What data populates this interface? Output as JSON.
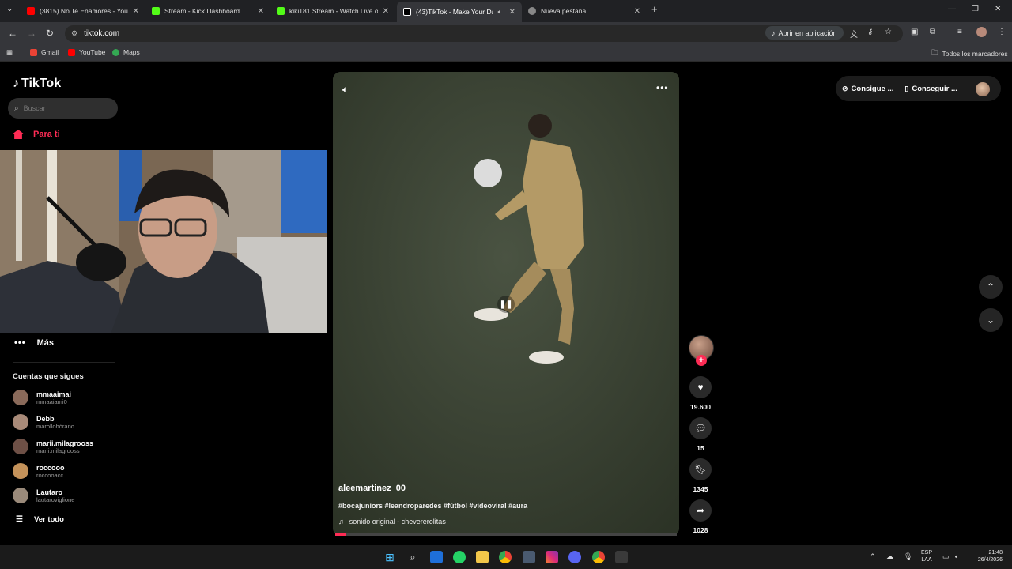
{
  "browser": {
    "tabs": [
      {
        "title": "(3815) No Te Enamores - YouTu",
        "color": "#ff0000"
      },
      {
        "title": "Stream - Kick Dashboard",
        "color": "#53fc18"
      },
      {
        "title": "kiki181 Stream - Watch Live on",
        "color": "#53fc18"
      },
      {
        "title": "(43)TikTok - Make Your Day",
        "color": "#ffffff"
      },
      {
        "title": "Nueva pestaña",
        "color": "#888888"
      }
    ],
    "new_tab_glyph": "+",
    "url": "tiktok.com",
    "open_in_app": "Abrir en aplicación",
    "bookmarks": [
      {
        "label": "Gmail",
        "color": "#ea4335"
      },
      {
        "label": "YouTube",
        "color": "#ff0000"
      },
      {
        "label": "Maps",
        "color": "#34a853"
      }
    ],
    "all_bookmarks": "Todos los marcadores"
  },
  "sidebar": {
    "logo": "TikTok",
    "search_placeholder": "Buscar",
    "for_you": "Para ti",
    "more": "Más",
    "following_title": "Cuentas que sigues",
    "accounts": [
      {
        "name": "mmaaimai",
        "handle": "mmaaiami0",
        "color": "#8a6a5a"
      },
      {
        "name": "Debb",
        "handle": "marollohórano",
        "color": "#a88a78"
      },
      {
        "name": "marii.milagrooss",
        "handle": "marii.milagrooss",
        "color": "#6e5046"
      },
      {
        "name": "roccooo",
        "handle": "roccooacc",
        "color": "#c4925a"
      },
      {
        "name": "Lautaro",
        "handle": "lautaroviglione",
        "color": "#9a8a7a"
      }
    ],
    "see_all": "Ver todo"
  },
  "video": {
    "author": "aleemartinez_00",
    "caption": "#bocajuniors #leandroparedes #fútbol #videoviral #aura",
    "sound": "sonido original - chevererolitas",
    "progress_percent": 3
  },
  "actions": {
    "likes": "19.600",
    "comments": "15",
    "saves": "1345",
    "shares": "1028"
  },
  "header": {
    "coins_label": "Consigue ...",
    "app_label": "Conseguir ..."
  },
  "taskbar": {
    "lang_line1": "ESP",
    "lang_line2": "LAA",
    "time": "21:48",
    "date": "26/4/2026"
  }
}
